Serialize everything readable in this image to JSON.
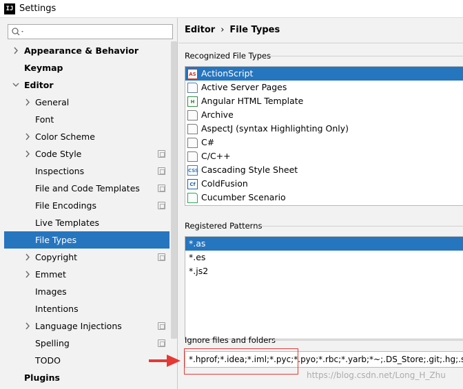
{
  "window": {
    "title": "Settings",
    "app_icon": "IJ"
  },
  "search": {
    "placeholder": "",
    "value": ""
  },
  "sidebar": {
    "items": [
      {
        "label": "Appearance & Behavior",
        "level": 0,
        "expandable": true,
        "expanded": false,
        "project_icon": false
      },
      {
        "label": "Keymap",
        "level": 0,
        "expandable": false,
        "project_icon": false
      },
      {
        "label": "Editor",
        "level": 0,
        "expandable": true,
        "expanded": true,
        "project_icon": false
      },
      {
        "label": "General",
        "level": 1,
        "expandable": true,
        "expanded": false,
        "project_icon": false
      },
      {
        "label": "Font",
        "level": 1,
        "expandable": false,
        "project_icon": false
      },
      {
        "label": "Color Scheme",
        "level": 1,
        "expandable": true,
        "expanded": false,
        "project_icon": false
      },
      {
        "label": "Code Style",
        "level": 1,
        "expandable": true,
        "expanded": false,
        "project_icon": true
      },
      {
        "label": "Inspections",
        "level": 1,
        "expandable": false,
        "project_icon": true
      },
      {
        "label": "File and Code Templates",
        "level": 1,
        "expandable": false,
        "project_icon": true
      },
      {
        "label": "File Encodings",
        "level": 1,
        "expandable": false,
        "project_icon": true
      },
      {
        "label": "Live Templates",
        "level": 1,
        "expandable": false,
        "project_icon": false
      },
      {
        "label": "File Types",
        "level": 1,
        "expandable": false,
        "project_icon": false,
        "selected": true
      },
      {
        "label": "Copyright",
        "level": 1,
        "expandable": true,
        "expanded": false,
        "project_icon": true
      },
      {
        "label": "Emmet",
        "level": 1,
        "expandable": true,
        "expanded": false,
        "project_icon": false
      },
      {
        "label": "Images",
        "level": 1,
        "expandable": false,
        "project_icon": false
      },
      {
        "label": "Intentions",
        "level": 1,
        "expandable": false,
        "project_icon": false
      },
      {
        "label": "Language Injections",
        "level": 1,
        "expandable": true,
        "expanded": false,
        "project_icon": true
      },
      {
        "label": "Spelling",
        "level": 1,
        "expandable": false,
        "project_icon": true
      },
      {
        "label": "TODO",
        "level": 1,
        "expandable": false,
        "project_icon": false
      },
      {
        "label": "Plugins",
        "level": 0,
        "expandable": false,
        "project_icon": false
      }
    ]
  },
  "breadcrumb": {
    "parent": "Editor",
    "separator": "›",
    "current": "File Types"
  },
  "recognized": {
    "label": "Recognized File Types",
    "items": [
      {
        "label": "ActionScript",
        "icon": "actionscript-icon",
        "badge": "AS",
        "color": "#c0392b",
        "selected": true
      },
      {
        "label": "Active Server Pages",
        "icon": "asp-file-icon",
        "badge": "",
        "color": "#5c7fa8"
      },
      {
        "label": "Angular HTML Template",
        "icon": "angular-html-icon",
        "badge": "H",
        "color": "#2e8b3e"
      },
      {
        "label": "Archive",
        "icon": "archive-icon",
        "badge": "",
        "color": "#7a7a7a"
      },
      {
        "label": "AspectJ (syntax Highlighting Only)",
        "icon": "aspectj-icon",
        "badge": "",
        "color": "#7a7a7a"
      },
      {
        "label": "C#",
        "icon": "csharp-file-icon",
        "badge": "",
        "color": "#7a7a7a"
      },
      {
        "label": "C/C++",
        "icon": "cpp-file-icon",
        "badge": "",
        "color": "#7a7a7a"
      },
      {
        "label": "Cascading Style Sheet",
        "icon": "css-icon",
        "badge": "CSS",
        "color": "#3b7bbf"
      },
      {
        "label": "ColdFusion",
        "icon": "coldfusion-icon",
        "badge": "Cf",
        "color": "#1f5fa5"
      },
      {
        "label": "Cucumber Scenario",
        "icon": "cucumber-icon",
        "badge": "",
        "color": "#2fa84f"
      }
    ]
  },
  "patterns": {
    "label": "Registered Patterns",
    "items": [
      {
        "label": "*.as",
        "selected": true
      },
      {
        "label": "*.es"
      },
      {
        "label": "*.js2"
      }
    ]
  },
  "ignore": {
    "label": "Ignore files and folders",
    "value": "*.hprof;*.idea;*.iml;*.pyc;*.pyo;*.rbc;*.yarb;*~;.DS_Store;.git;.hg;.svn;CV"
  },
  "watermark": "https://blog.csdn.net/Long_H_Zhu",
  "colors": {
    "selection": "#2675bf",
    "highlight": "#e53935"
  }
}
